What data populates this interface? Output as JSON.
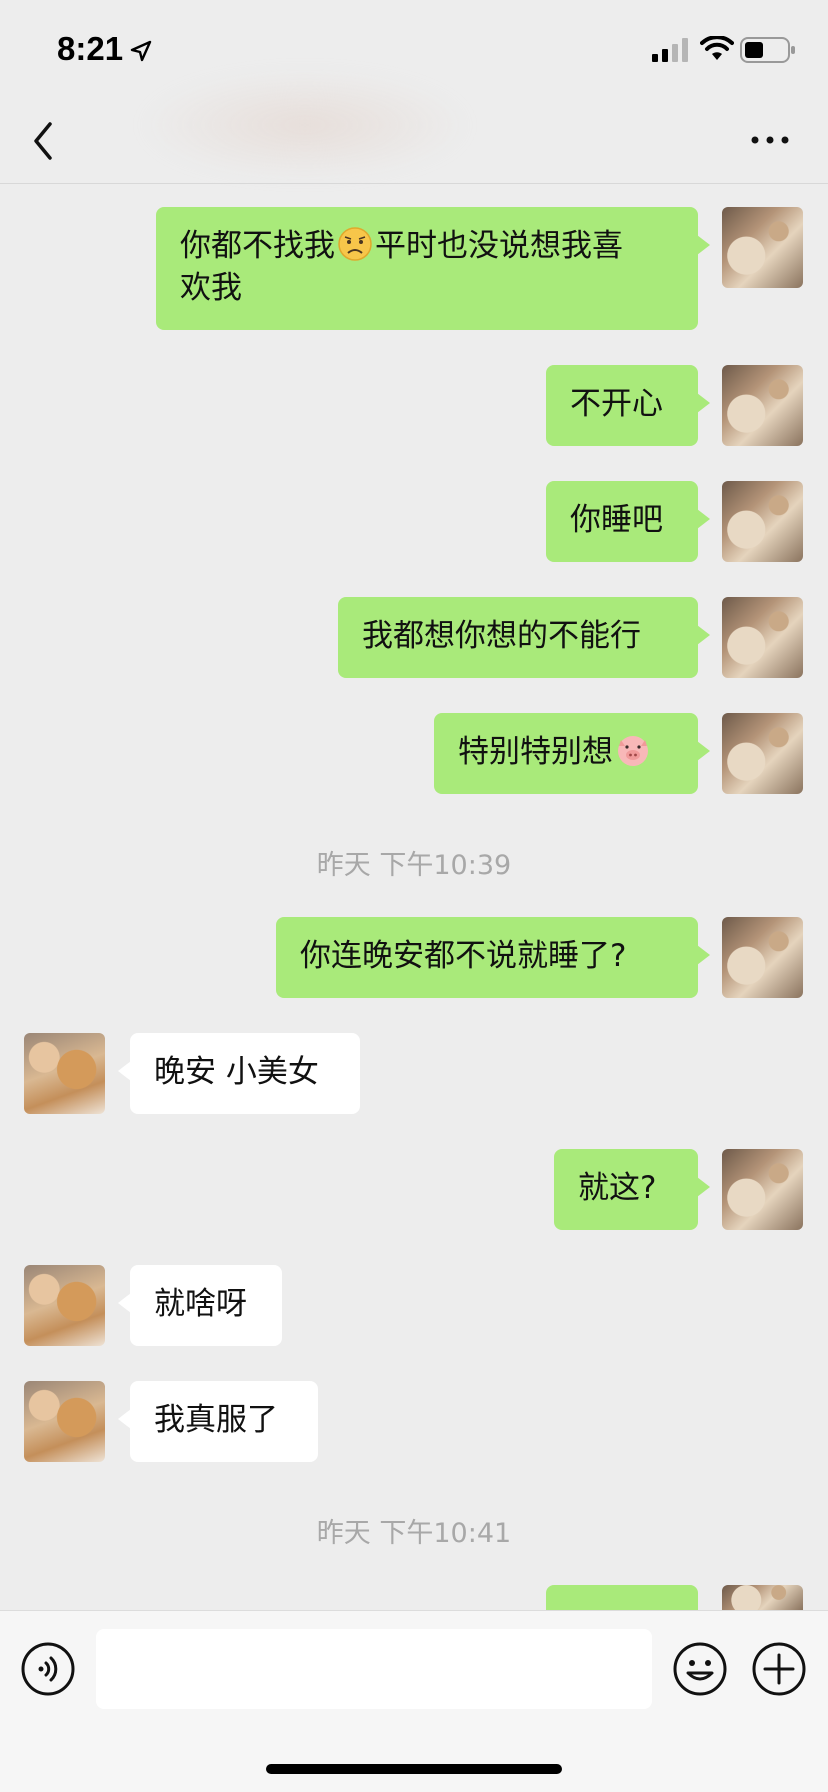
{
  "status_bar": {
    "time": "8:21",
    "icons": [
      "location-arrow-icon",
      "signal-icon",
      "wifi-icon",
      "battery-icon"
    ]
  },
  "nav": {
    "back_icon": "chevron-left-icon",
    "more_icon": "more-dots-icon"
  },
  "messages": [
    {
      "side": "mine",
      "parts": [
        "你都不找我",
        "平时也没说想我喜欢我"
      ],
      "emoji": "frowning-face"
    },
    {
      "side": "mine",
      "text": "不开心"
    },
    {
      "side": "mine",
      "text": "你睡吧"
    },
    {
      "side": "mine",
      "text": "我都想你想的不能行"
    },
    {
      "side": "mine",
      "text": "特别特别想",
      "emoji": "pig-face"
    },
    {
      "type": "timestamp",
      "text": "昨天 下午10:39"
    },
    {
      "side": "mine",
      "text": "你连晚安都不说就睡了?"
    },
    {
      "side": "theirs",
      "text": "晚安 小美女"
    },
    {
      "side": "mine",
      "text": "就这?"
    },
    {
      "side": "theirs",
      "text": "就啥呀"
    },
    {
      "side": "theirs",
      "text": "我真服了"
    },
    {
      "type": "timestamp",
      "text": "昨天 下午10:41"
    }
  ],
  "msg_1_line1": "你都不找我",
  "msg_1_line1b": "平时也没说想我喜",
  "msg_1_line2": "欢我",
  "msg_2": "不开心",
  "msg_3": "你睡吧",
  "msg_4": "我都想你想的不能行",
  "msg_5": "特别特别想",
  "ts_1": "昨天 下午10:39",
  "msg_6": "你连晚安都不说就睡了?",
  "msg_7": "晚安 小美女",
  "msg_8": "就这?",
  "msg_9": "就啥呀",
  "msg_10": "我真服了",
  "ts_2": "昨天 下午10:41",
  "input": {
    "value": "",
    "voice_icon": "voice-icon",
    "emoji_icon": "smiley-icon",
    "plus_icon": "plus-circle-icon"
  },
  "colors": {
    "background": "#ededed",
    "my_bubble": "#a9ea7a",
    "their_bubble": "#ffffff",
    "timestamp": "#a8a8a8"
  }
}
